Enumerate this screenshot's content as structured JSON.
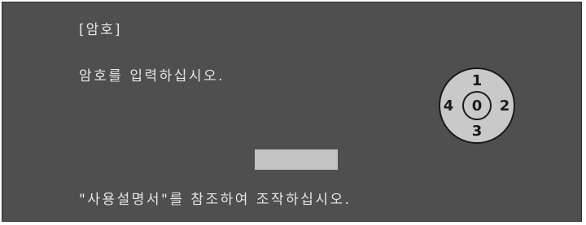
{
  "dialog": {
    "title": "[암호]",
    "instruction": "암호를 입력하십시오.",
    "footer_note": "\"사용설명서\"를 참조하여 조작하십시오.",
    "password_value": ""
  },
  "keypad": {
    "up": "1",
    "right": "2",
    "down": "3",
    "left": "4",
    "center": "0"
  },
  "colors": {
    "background": "#4f4f4f",
    "text": "#e6e6e6",
    "field": "#c2c2c2",
    "keypad_fill": "#c9c9c9",
    "keypad_stroke": "#1a1a1a"
  }
}
